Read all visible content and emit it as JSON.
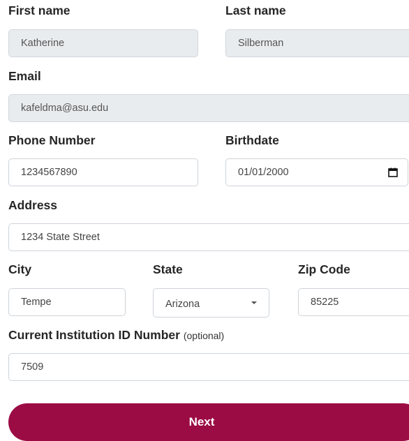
{
  "first_name": {
    "label": "First name",
    "value": "Katherine"
  },
  "last_name": {
    "label": "Last name",
    "value": "Silberman"
  },
  "email": {
    "label": "Email",
    "value": "kafeldma@asu.edu"
  },
  "phone": {
    "label": "Phone Number",
    "value": "1234567890"
  },
  "birthdate": {
    "label": "Birthdate",
    "value": "01/01/2000",
    "icon": "calendar-icon"
  },
  "address": {
    "label": "Address",
    "value": "1234 State Street"
  },
  "city": {
    "label": "City",
    "value": "Tempe"
  },
  "state": {
    "label": "State",
    "value": "Arizona",
    "icon": "chevron-down-icon"
  },
  "zip": {
    "label": "Zip Code",
    "value": "85225"
  },
  "institution_id": {
    "label": "Current Institution ID Number",
    "optional": "(optional)",
    "value": "7509"
  },
  "next_button": {
    "label": "Next"
  },
  "colors": {
    "accent": "#9b0c45",
    "readonly_bg": "#e9ecef"
  }
}
